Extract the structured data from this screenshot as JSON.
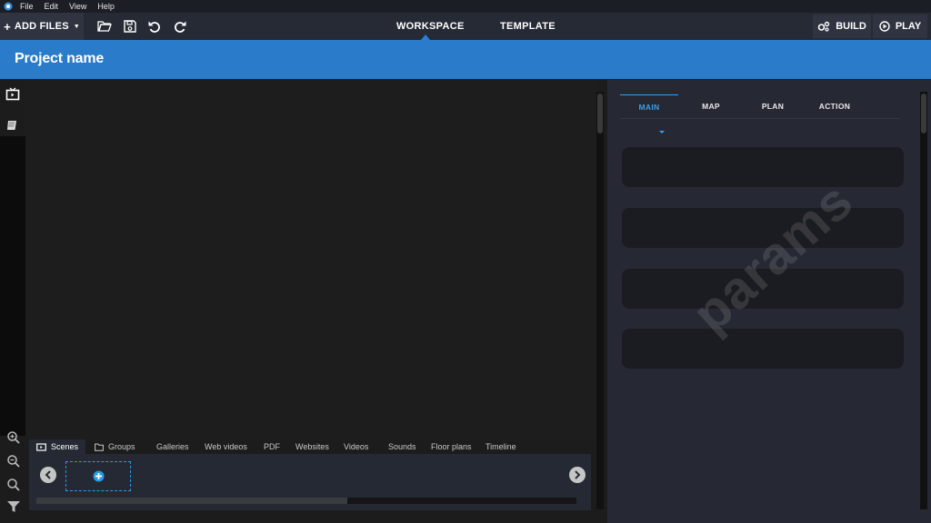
{
  "menubar": {
    "items": [
      "File",
      "Edit",
      "View",
      "Help"
    ]
  },
  "toolbar": {
    "add_files_label": "ADD FILES",
    "tabs": [
      "WORKSPACE",
      "TEMPLATE"
    ],
    "active_tab": "WORKSPACE",
    "build_label": "BUILD",
    "play_label": "PLAY"
  },
  "project": {
    "title": "Project name"
  },
  "bottom_tabs": [
    "Scenes",
    "Groups",
    "Galleries",
    "Web videos",
    "PDF",
    "Websites",
    "Videos",
    "Sounds",
    "Floor plans",
    "Timeline"
  ],
  "bottom_active_tab": "Scenes",
  "right_panel": {
    "tabs": [
      "MAIN",
      "MAP",
      "PLAN",
      "ACTION"
    ],
    "active_tab": "MAIN",
    "watermark": "params"
  },
  "colors": {
    "accent": "#2a7bca",
    "highlight": "#3aa0e6"
  }
}
